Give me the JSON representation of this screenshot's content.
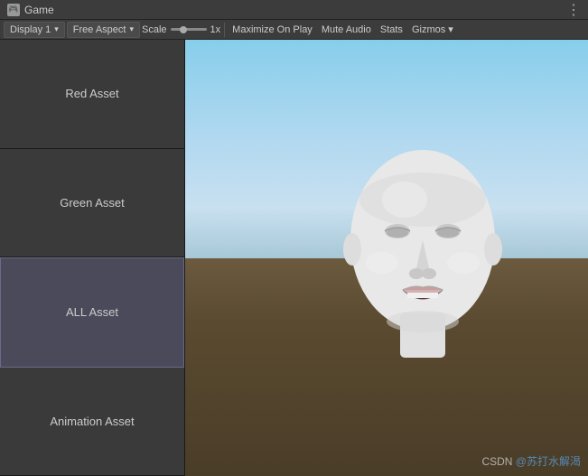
{
  "titleBar": {
    "icon": "🎮",
    "title": "Game",
    "menuIcon": "⋮"
  },
  "toolbar": {
    "display": "Display 1",
    "aspect": "Free Aspect",
    "scaleLabel": "Scale",
    "scaleValue": "1x",
    "maximizeOnPlay": "Maximize On Play",
    "muteAudio": "Mute Audio",
    "stats": "Stats",
    "gizmos": "Gizmos"
  },
  "leftPanel": {
    "buttons": [
      {
        "id": "red-asset",
        "label": "Red Asset",
        "active": false
      },
      {
        "id": "green-asset",
        "label": "Green Asset",
        "active": false
      },
      {
        "id": "all-asset",
        "label": "ALL Asset",
        "active": true
      },
      {
        "id": "animation-asset",
        "label": "Animation Asset",
        "active": false
      }
    ]
  },
  "viewport": {
    "watermarkSite": "CSDN",
    "watermarkAt": "@",
    "watermarkUser": "苏打水解渴"
  }
}
